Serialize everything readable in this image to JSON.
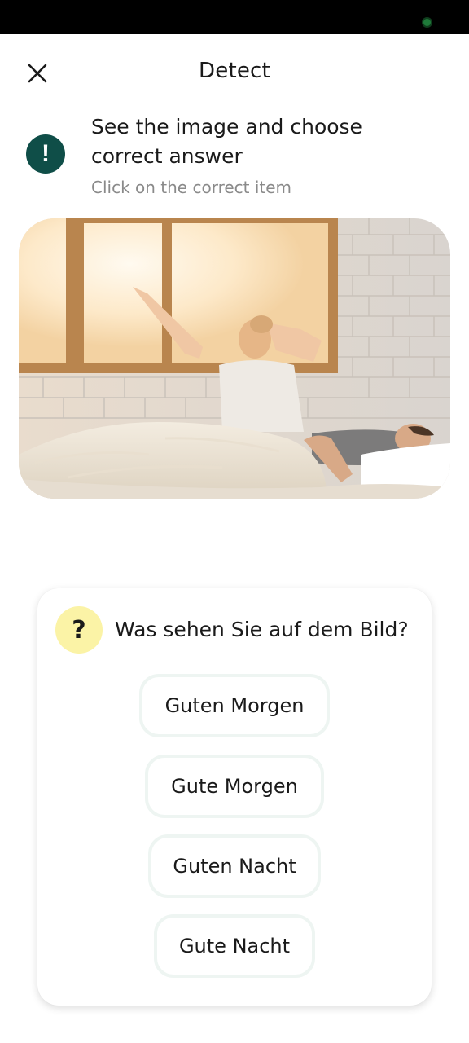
{
  "header": {
    "title": "Detect",
    "close_icon": "close-icon"
  },
  "instruction": {
    "icon": "exclamation-icon",
    "title": "See the image and choose correct answer",
    "subtitle": "Click on the correct item"
  },
  "image": {
    "alt": "woman stretching by window in bed next to sleeping man"
  },
  "question": {
    "icon": "question-mark-icon",
    "text": "Was sehen Sie auf dem Bild?",
    "options": [
      "Guten Morgen",
      "Gute Morgen",
      "Guten Nacht",
      "Gute Nacht"
    ]
  },
  "colors": {
    "accent": "#0f4e48",
    "question_badge": "#fbf3a6",
    "option_border": "#eef5f2"
  }
}
